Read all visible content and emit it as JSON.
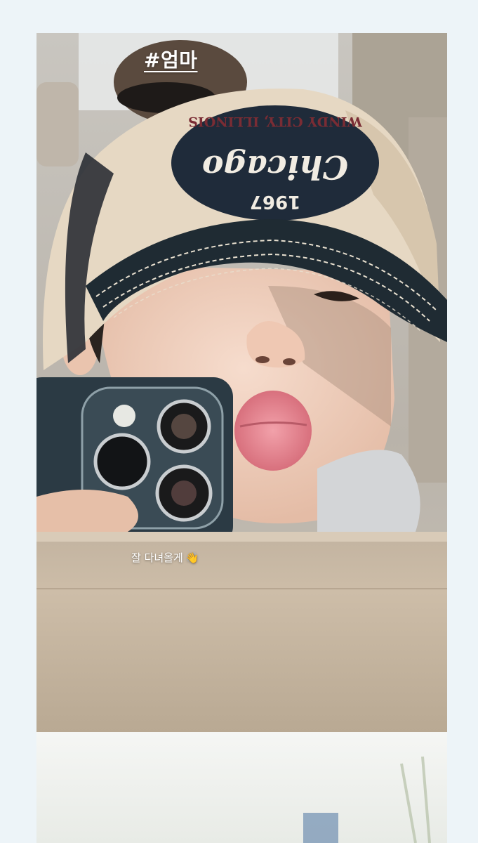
{
  "story": {
    "hashtag": "#엄마",
    "caption": "잘 다녀올게",
    "caption_emoji": "👋"
  },
  "photo": {
    "cap_text_top": "WINDY CITY, ILLINOIS",
    "cap_text_script": "Chicago",
    "cap_text_year": "1967"
  },
  "colors": {
    "background": "#edf4f8",
    "text": "#ffffff",
    "cap_navy": "#1f2b3a",
    "cap_cream": "#e9dcc8",
    "lips": "#e0848f",
    "phone": "#2b3a44"
  }
}
